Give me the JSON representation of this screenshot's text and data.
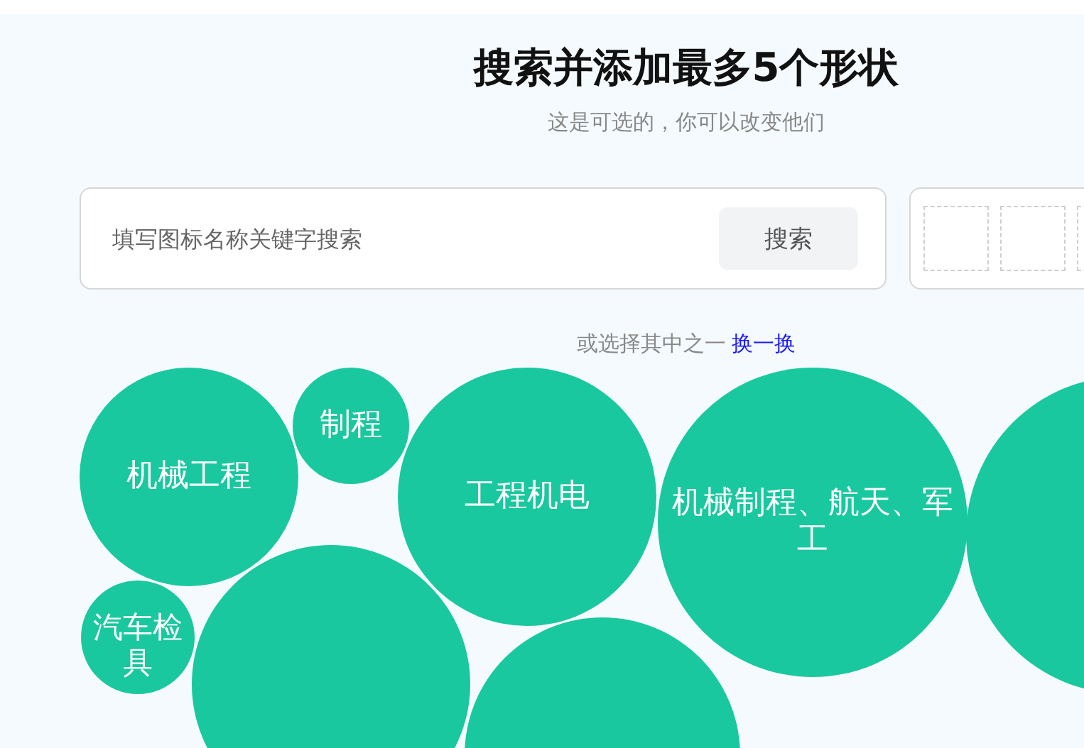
{
  "title": "搜索并添加最多5个形状",
  "subtitle": "这是可选的，你可以改变他们",
  "search": {
    "placeholder": "填写图标名称关键字搜索",
    "button": "搜索"
  },
  "hint": {
    "text": "或选择其中之一",
    "link": "换一换"
  },
  "bubbles": [
    {
      "label": "机械工程"
    },
    {
      "label": "制程"
    },
    {
      "label": "工程机电"
    },
    {
      "label": "机械制程、航天、军工"
    },
    {
      "label": "汽车检具"
    }
  ]
}
